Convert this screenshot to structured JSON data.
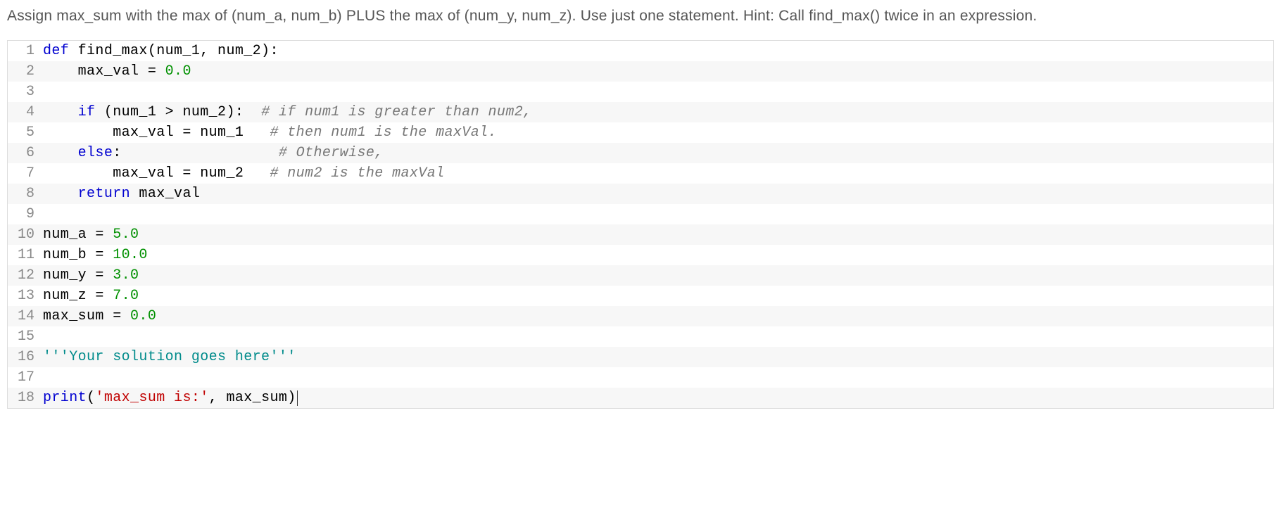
{
  "instructions": "Assign max_sum with the max of (num_a, num_b) PLUS the max of (num_y, num_z). Use just one statement. Hint: Call find_max() twice in an expression.",
  "code": {
    "lines": [
      {
        "n": 1,
        "segments": [
          {
            "t": "def ",
            "c": "kw"
          },
          {
            "t": "find_max(num_1, num_2):",
            "c": "fn"
          }
        ]
      },
      {
        "n": 2,
        "segments": [
          {
            "t": "    max_val = ",
            "c": "fn"
          },
          {
            "t": "0.0",
            "c": "num"
          }
        ]
      },
      {
        "n": 3,
        "segments": []
      },
      {
        "n": 4,
        "segments": [
          {
            "t": "    ",
            "c": "fn"
          },
          {
            "t": "if",
            "c": "kw"
          },
          {
            "t": " (num_1 > num_2):  ",
            "c": "fn"
          },
          {
            "t": "# if num1 is greater than num2,",
            "c": "comment"
          }
        ]
      },
      {
        "n": 5,
        "segments": [
          {
            "t": "        max_val = num_1   ",
            "c": "fn"
          },
          {
            "t": "# then num1 is the maxVal.",
            "c": "comment"
          }
        ]
      },
      {
        "n": 6,
        "segments": [
          {
            "t": "    ",
            "c": "fn"
          },
          {
            "t": "else",
            "c": "kw"
          },
          {
            "t": ":                  ",
            "c": "fn"
          },
          {
            "t": "# Otherwise,",
            "c": "comment"
          }
        ]
      },
      {
        "n": 7,
        "segments": [
          {
            "t": "        max_val = num_2   ",
            "c": "fn"
          },
          {
            "t": "# num2 is the maxVal",
            "c": "comment"
          }
        ]
      },
      {
        "n": 8,
        "segments": [
          {
            "t": "    ",
            "c": "fn"
          },
          {
            "t": "return",
            "c": "kw"
          },
          {
            "t": " max_val",
            "c": "fn"
          }
        ]
      },
      {
        "n": 9,
        "segments": []
      },
      {
        "n": 10,
        "segments": [
          {
            "t": "num_a = ",
            "c": "fn"
          },
          {
            "t": "5.0",
            "c": "num"
          }
        ]
      },
      {
        "n": 11,
        "segments": [
          {
            "t": "num_b = ",
            "c": "fn"
          },
          {
            "t": "10.0",
            "c": "num"
          }
        ]
      },
      {
        "n": 12,
        "segments": [
          {
            "t": "num_y = ",
            "c": "fn"
          },
          {
            "t": "3.0",
            "c": "num"
          }
        ]
      },
      {
        "n": 13,
        "segments": [
          {
            "t": "num_z = ",
            "c": "fn"
          },
          {
            "t": "7.0",
            "c": "num"
          }
        ]
      },
      {
        "n": 14,
        "segments": [
          {
            "t": "max_sum = ",
            "c": "fn"
          },
          {
            "t": "0.0",
            "c": "num"
          }
        ]
      },
      {
        "n": 15,
        "segments": []
      },
      {
        "n": 16,
        "segments": [
          {
            "t": "'''Your solution goes here'''",
            "c": "solution-str"
          }
        ]
      },
      {
        "n": 17,
        "segments": []
      },
      {
        "n": 18,
        "segments": [
          {
            "t": "print",
            "c": "kw"
          },
          {
            "t": "(",
            "c": "fn"
          },
          {
            "t": "'max_sum is:'",
            "c": "str"
          },
          {
            "t": ", max_sum)",
            "c": "fn"
          }
        ],
        "cursor": true
      }
    ]
  }
}
